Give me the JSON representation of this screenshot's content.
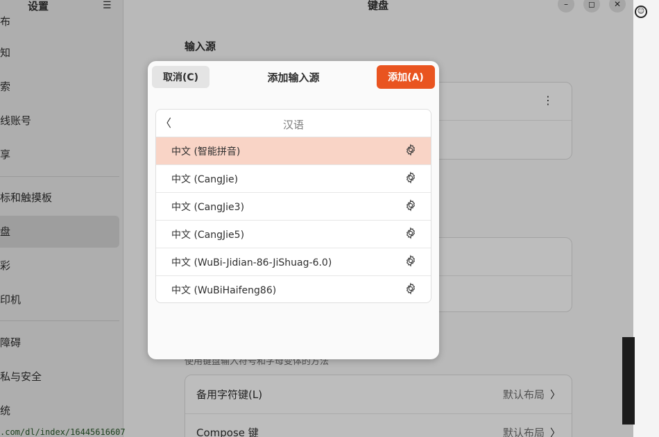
{
  "sidebar": {
    "title": "设置",
    "menu_icon": "hamburger-menu-icon",
    "items": [
      {
        "label": "布",
        "name": "sidebar-item-wallpaper"
      },
      {
        "label": "知",
        "name": "sidebar-item-notifications"
      },
      {
        "label": "索",
        "name": "sidebar-item-search"
      },
      {
        "label": "线账号",
        "name": "sidebar-item-online-accounts"
      },
      {
        "label": "享",
        "name": "sidebar-item-sharing"
      },
      {
        "label": "标和触摸板",
        "name": "sidebar-item-mouse-touchpad"
      },
      {
        "label": "盘",
        "name": "sidebar-item-keyboard"
      },
      {
        "label": "彩",
        "name": "sidebar-item-color"
      },
      {
        "label": "印机",
        "name": "sidebar-item-printers"
      },
      {
        "label": "障碍",
        "name": "sidebar-item-accessibility"
      },
      {
        "label": "私与安全",
        "name": "sidebar-item-privacy"
      },
      {
        "label": "统",
        "name": "sidebar-item-system"
      }
    ],
    "url_fragment": ".com/dl/index/16445616607"
  },
  "header": {
    "title": "键盘",
    "minimize": "–",
    "maximize": "◻",
    "close": "✕"
  },
  "main": {
    "section_title": "输入源",
    "alt_desc": "使用键盘输入符号和字母变体的方法",
    "rows": [
      {
        "label": "备用字符键(L)",
        "value": "默认布局"
      },
      {
        "label": "Compose 键",
        "value": "默认布局"
      }
    ]
  },
  "dialog": {
    "cancel_label": "取消(C)",
    "title": "添加输入源",
    "add_label": "添加(A)",
    "list_title": "汉语",
    "back_glyph": "〈",
    "items": [
      {
        "label": "中文 (智能拼音)",
        "selected": true
      },
      {
        "label": "中文 (CangJie)",
        "selected": false
      },
      {
        "label": "中文 (CangJie3)",
        "selected": false
      },
      {
        "label": "中文 (CangJie5)",
        "selected": false
      },
      {
        "label": "中文 (WuBi-Jidian-86-JiShuag-6.0)",
        "selected": false
      },
      {
        "label": "中文 (WuBiHaifeng86)",
        "selected": false
      }
    ]
  },
  "colors": {
    "accent": "#e95420",
    "selected_row": "#f9d4c6"
  },
  "icons": {
    "settings": "gear-icon",
    "back": "chevron-left-icon",
    "more": "vertical-dots-icon",
    "forward": "chevron-right-icon"
  }
}
